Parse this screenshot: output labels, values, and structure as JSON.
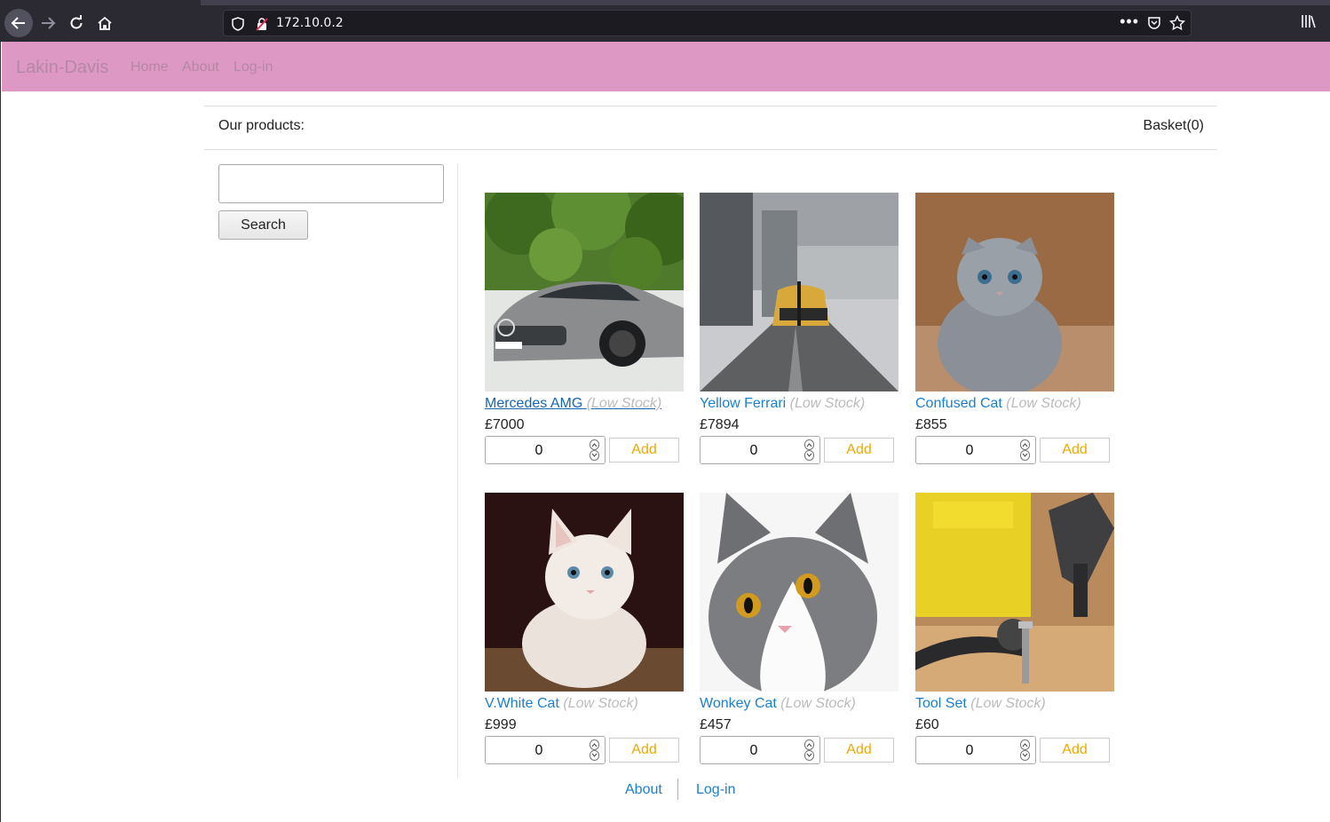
{
  "browser": {
    "url": "172.10.0.2",
    "more_label": "•••"
  },
  "site": {
    "brand": "Lakin-Davis",
    "nav": [
      "Home",
      "About",
      "Log-in"
    ],
    "brand_color": "#de98c4"
  },
  "header": {
    "title": "Our products:",
    "basket": "Basket(0)"
  },
  "search": {
    "placeholder": "",
    "button_label": "Search"
  },
  "products": [
    {
      "name": "Mercedes AMG ",
      "stock": "(Low Stock)",
      "price": "£7000",
      "qty": "0",
      "add_label": "Add",
      "image": "silver-car"
    },
    {
      "name": "Yellow Ferrari ",
      "stock": "(Low Stock)",
      "price": "£7894",
      "qty": "0",
      "add_label": "Add",
      "image": "yellow-car"
    },
    {
      "name": "Confused Cat ",
      "stock": "(Low Stock)",
      "price": "£855",
      "qty": "0",
      "add_label": "Add",
      "image": "grey-kitten"
    },
    {
      "name": "V.White Cat ",
      "stock": "(Low Stock)",
      "price": "£999",
      "qty": "0",
      "add_label": "Add",
      "image": "white-kitten"
    },
    {
      "name": "Wonkey Cat ",
      "stock": "(Low Stock)",
      "price": "£457",
      "qty": "0",
      "add_label": "Add",
      "image": "grey-white-cat"
    },
    {
      "name": "Tool Set ",
      "stock": "(Low Stock)",
      "price": "£60",
      "qty": "0",
      "add_label": "Add",
      "image": "tools"
    }
  ],
  "footer": {
    "links": [
      "About",
      "Log-in"
    ]
  }
}
